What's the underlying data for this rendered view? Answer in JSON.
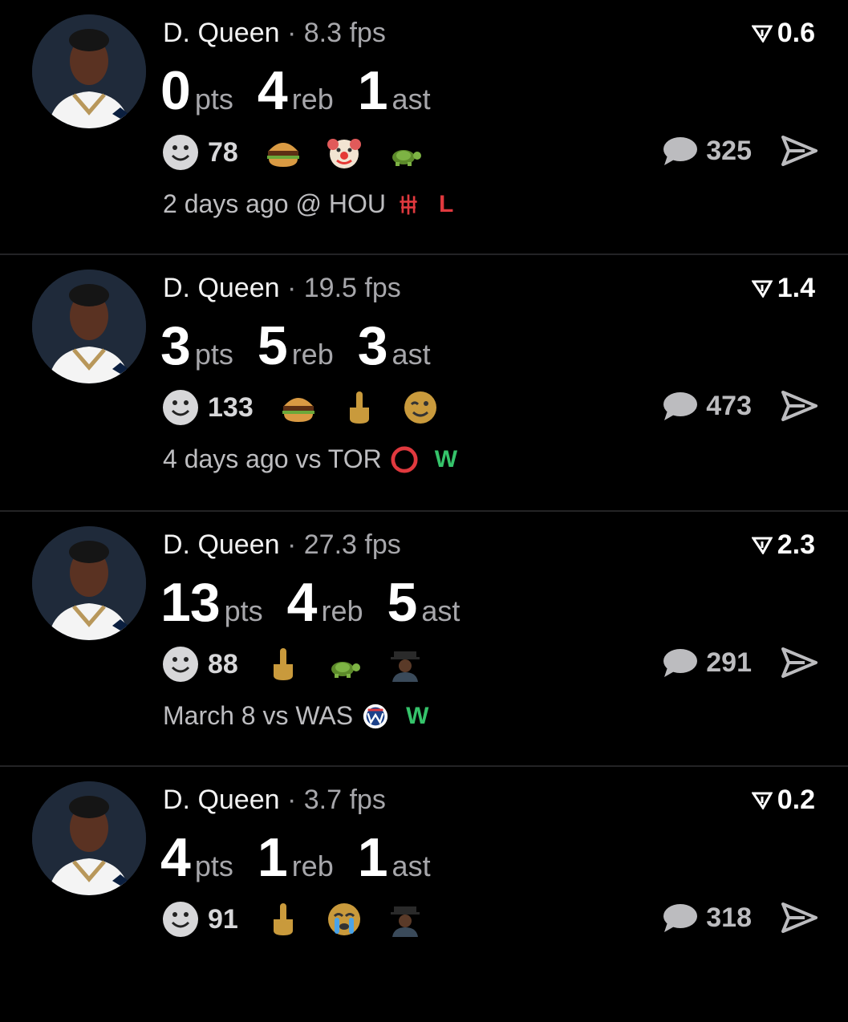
{
  "colors": {
    "background": "#000000",
    "win": "#35c36a",
    "loss": "#e0393e",
    "muted": "#a7a7ab"
  },
  "icons": {
    "rating": "drop-arrow-icon",
    "reaction": "smiley-icon",
    "comment": "speech-bubble-icon",
    "share": "send-icon"
  },
  "games": [
    {
      "player": "D. Queen",
      "separator": "·",
      "fps": "8.3 fps",
      "rating": "0.6",
      "stats": [
        {
          "value": "0",
          "unit": "pts"
        },
        {
          "value": "4",
          "unit": "reb"
        },
        {
          "value": "1",
          "unit": "ast"
        }
      ],
      "reaction_count": "78",
      "emojis": [
        "burger-emoji",
        "clown-emoji",
        "turtle-emoji"
      ],
      "comments": "325",
      "when": "2 days ago @ HOU",
      "team_logo": "rockets-logo",
      "result": "L"
    },
    {
      "player": "D. Queen",
      "separator": "·",
      "fps": "19.5 fps",
      "rating": "1.4",
      "stats": [
        {
          "value": "3",
          "unit": "pts"
        },
        {
          "value": "5",
          "unit": "reb"
        },
        {
          "value": "3",
          "unit": "ast"
        }
      ],
      "reaction_count": "133",
      "emojis": [
        "burger-emoji",
        "middle-finger-emoji",
        "winking-face-emoji"
      ],
      "comments": "473",
      "when": "4 days ago vs TOR",
      "team_logo": "raptors-logo",
      "result": "W"
    },
    {
      "player": "D. Queen",
      "separator": "·",
      "fps": "27.3 fps",
      "rating": "2.3",
      "stats": [
        {
          "value": "13",
          "unit": "pts"
        },
        {
          "value": "4",
          "unit": "reb"
        },
        {
          "value": "5",
          "unit": "ast"
        }
      ],
      "reaction_count": "88",
      "emojis": [
        "middle-finger-emoji",
        "turtle-emoji",
        "person-with-hat-emoji"
      ],
      "comments": "291",
      "when": "March 8 vs WAS",
      "team_logo": "wizards-logo",
      "result": "W"
    },
    {
      "player": "D. Queen",
      "separator": "·",
      "fps": "3.7 fps",
      "rating": "0.2",
      "stats": [
        {
          "value": "4",
          "unit": "pts"
        },
        {
          "value": "1",
          "unit": "reb"
        },
        {
          "value": "1",
          "unit": "ast"
        }
      ],
      "reaction_count": "91",
      "emojis": [
        "middle-finger-emoji",
        "crying-face-emoji",
        "person-with-hat-emoji"
      ],
      "comments": "318",
      "when": "",
      "team_logo": "",
      "result": ""
    }
  ]
}
